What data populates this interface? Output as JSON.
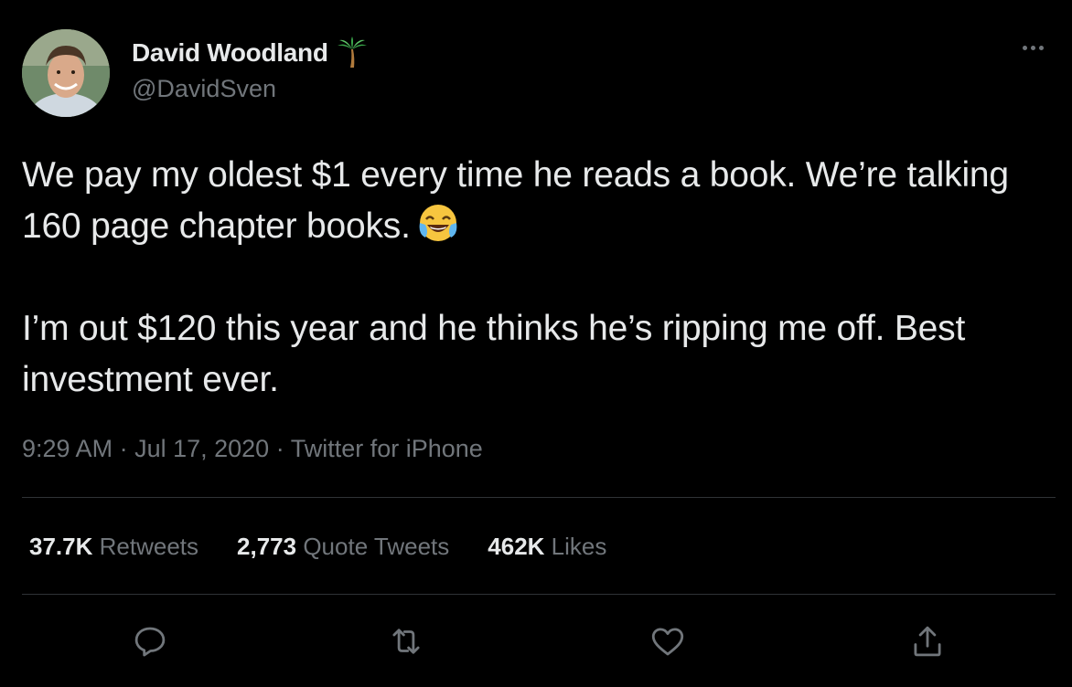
{
  "author": {
    "display_name": "David Woodland",
    "handle": "@DavidSven",
    "name_emoji": "palm-tree-icon"
  },
  "tweet": {
    "paragraph_1": "We pay my oldest $1 every time he reads a book. We’re talking 160 page chapter books.",
    "paragraph_1_emoji": "face-with-tears-of-joy-icon",
    "paragraph_2": "I’m out $120 this year and he thinks he’s ripping me off. Best investment ever.",
    "time": "9:29 AM",
    "sep1": " · ",
    "date": "Jul 17, 2020",
    "sep2": " · ",
    "source": "Twitter for iPhone"
  },
  "stats": {
    "retweets_count": "37.7K",
    "retweets_label": "Retweets",
    "quotes_count": "2,773",
    "quotes_label": "Quote Tweets",
    "likes_count": "462K",
    "likes_label": "Likes"
  },
  "colors": {
    "background": "#000000",
    "text_primary": "#e7e9ea",
    "text_secondary": "#71767b",
    "divider": "#2f3336"
  }
}
